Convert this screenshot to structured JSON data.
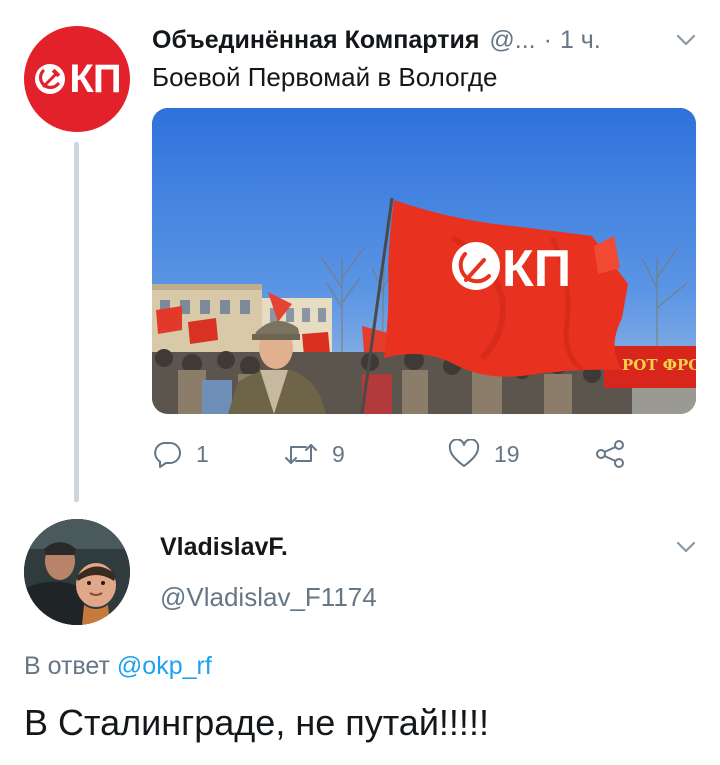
{
  "parent_tweet": {
    "avatar_icon": "okp-logo-icon",
    "avatar_text": "КП",
    "name": "Объединённая Компартия",
    "handle": "@...",
    "separator": "·",
    "time": "1 ч.",
    "text": "Боевой Первомай в Вологде",
    "media": {
      "banner_text": "РОТ ФРОНТ",
      "flag_text": "КП"
    },
    "actions": {
      "reply_count": "1",
      "retweet_count": "9",
      "like_count": "19"
    }
  },
  "reply_tweet": {
    "name": "VladislavF.",
    "handle": "@Vladislav_F1174",
    "reply_prefix": "В ответ",
    "reply_mention": "@okp_rf",
    "text": "В Сталинграде, не путай!!!!!"
  },
  "colors": {
    "brand_red": "#e3212b",
    "secondary_text": "#657786",
    "link": "#1da1f2",
    "thread_line": "#ccd6dd"
  }
}
